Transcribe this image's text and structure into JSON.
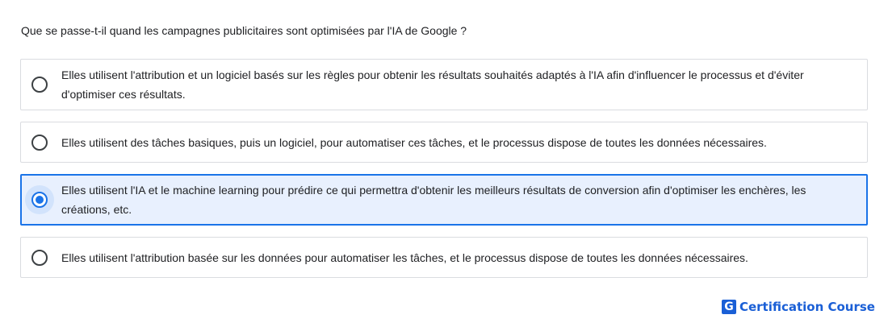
{
  "question": "Que se passe-t-il quand les campagnes publicitaires sont optimisées par l'IA de Google ?",
  "options": [
    {
      "label": "Elles utilisent l'attribution et un logiciel basés sur les règles pour obtenir les résultats souhaités adaptés à l'IA afin d'influencer le processus et d'éviter d'optimiser ces résultats.",
      "selected": false
    },
    {
      "label": "Elles utilisent des tâches basiques, puis un logiciel, pour automatiser ces tâches, et le processus dispose de toutes les données nécessaires.",
      "selected": false
    },
    {
      "label": "Elles utilisent l'IA et le machine learning pour prédire ce qui permettra d'obtenir les meilleurs résultats de conversion afin d'optimiser les enchères, les créations, etc.",
      "selected": true
    },
    {
      "label": "Elles utilisent l'attribution basée sur les données pour automatiser les tâches, et le processus dispose de toutes les données nécessaires.",
      "selected": false
    }
  ],
  "brand": {
    "logo_letter": "G",
    "name": "Certification Course",
    "color": "#1a5fd6"
  },
  "colors": {
    "accent": "#1a73e8",
    "selected_bg": "#e8f0fe",
    "border": "#dadce0"
  }
}
